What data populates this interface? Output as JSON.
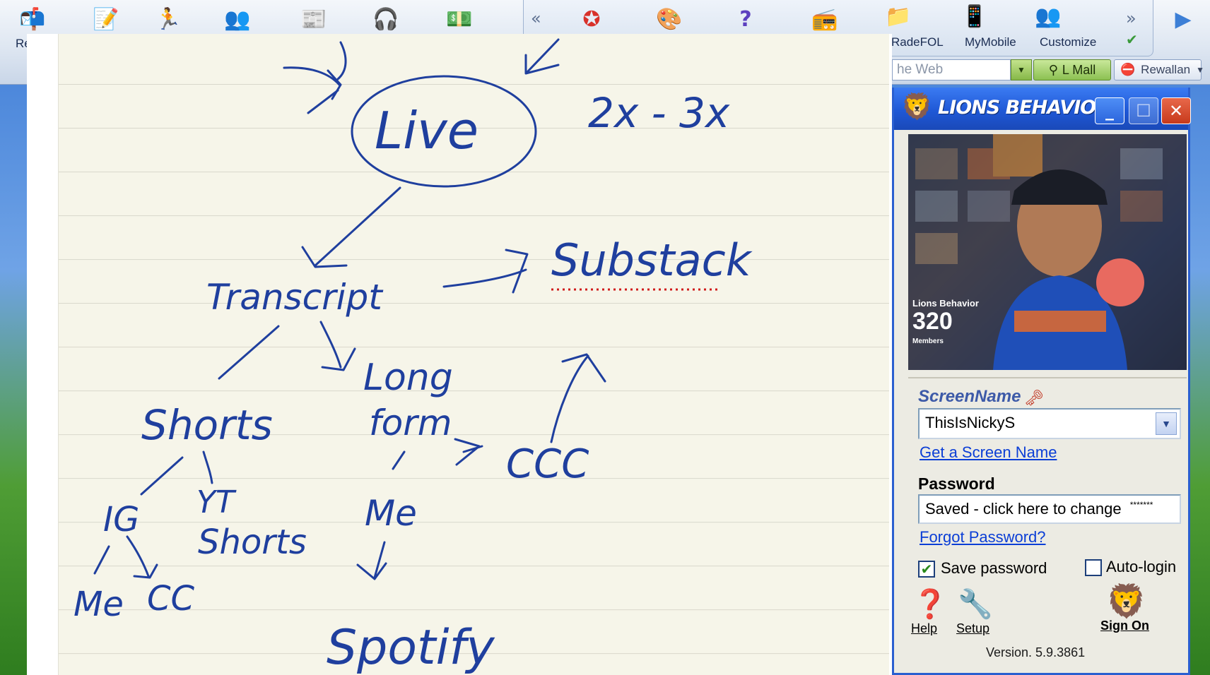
{
  "toolbar": {
    "left_icons": [
      {
        "name": "mail-icon",
        "glyph": "📬",
        "partial_label": "Re"
      },
      {
        "name": "write-icon",
        "glyph": "📝"
      },
      {
        "name": "running-man-icon",
        "glyph": "🏃"
      },
      {
        "name": "people-icon",
        "glyph": "👥"
      },
      {
        "name": "news-icon",
        "glyph": "📰"
      },
      {
        "name": "headphones-icon",
        "glyph": "🎧"
      },
      {
        "name": "money-icon",
        "glyph": "💵"
      }
    ],
    "right_items": [
      {
        "name": "star-icon",
        "glyph": "✪"
      },
      {
        "name": "palette-icon",
        "glyph": "🎨"
      },
      {
        "name": "help-icon",
        "glyph": "?"
      },
      {
        "name": "radio-icon",
        "glyph": "📻"
      },
      {
        "name": "radefol-icon",
        "glyph": "📁",
        "label": "RadeFOL"
      },
      {
        "name": "mymobile-icon",
        "glyph": "📱",
        "label": "MyMobile"
      },
      {
        "name": "customize-icon",
        "glyph": "👥",
        "label": "Customize"
      }
    ],
    "search_value": "he Web",
    "mall_label": "L Mall",
    "rewallan_label": "Rewallan"
  },
  "notes": {
    "live": "Live",
    "multiplier": "2x - 3x",
    "transcript": "Transcript",
    "substack": "Substack",
    "long": "Long",
    "form": "form",
    "shorts": "Shorts",
    "ccc": "CCC",
    "ig": "IG",
    "yt": "YT",
    "yt_shorts": "Shorts",
    "me_left": "Me",
    "cc": "CC",
    "me_mid": "Me",
    "spotify": "Spotify"
  },
  "aim": {
    "title": "LIONS BEHAVIOR",
    "photo_group_name": "Lions Behavior",
    "photo_members_count": "320",
    "photo_members_label": "Members",
    "screenname_label": "ScreenName",
    "screenname_value": "ThisIsNickyS",
    "get_screen_name": "Get a Screen Name",
    "password_label": "Password",
    "password_value": "Saved - click here to change",
    "password_mask": "*******",
    "forgot_password": "Forgot Password?",
    "save_password": "Save password",
    "save_password_checked": true,
    "auto_login": "Auto-login",
    "auto_login_checked": false,
    "help": "Help",
    "setup": "Setup",
    "sign_on": "Sign On",
    "version": "Version. 5.9.3861"
  }
}
